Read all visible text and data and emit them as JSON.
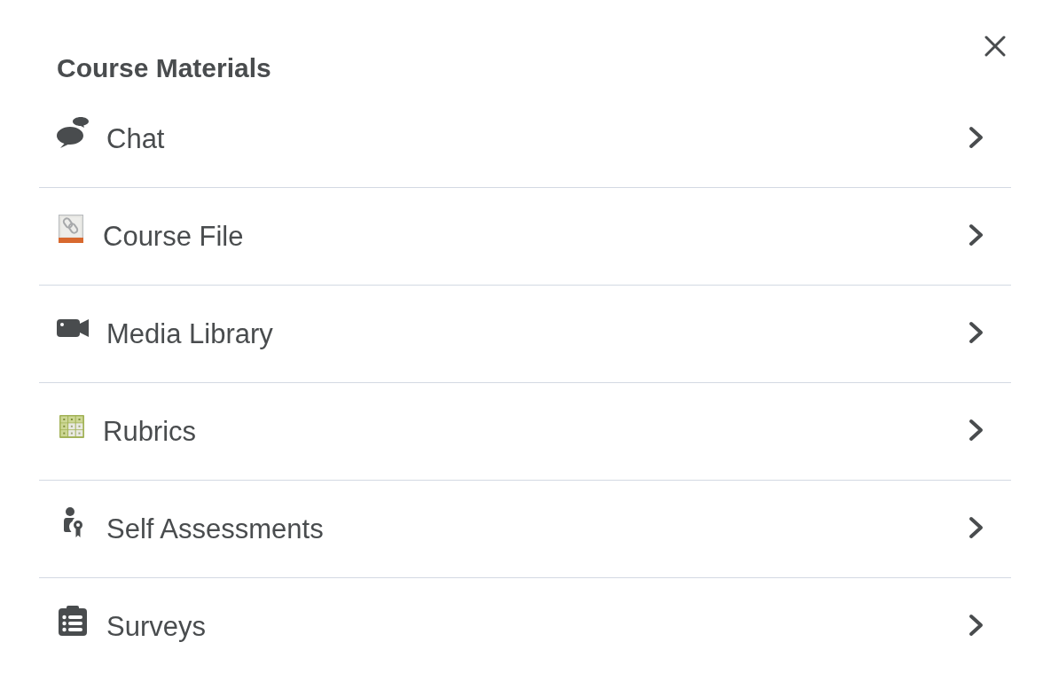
{
  "panel": {
    "title": "Course Materials",
    "items": [
      {
        "label": "Chat"
      },
      {
        "label": "Course File"
      },
      {
        "label": "Media Library"
      },
      {
        "label": "Rubrics"
      },
      {
        "label": "Self Assessments"
      },
      {
        "label": "Surveys"
      }
    ]
  }
}
